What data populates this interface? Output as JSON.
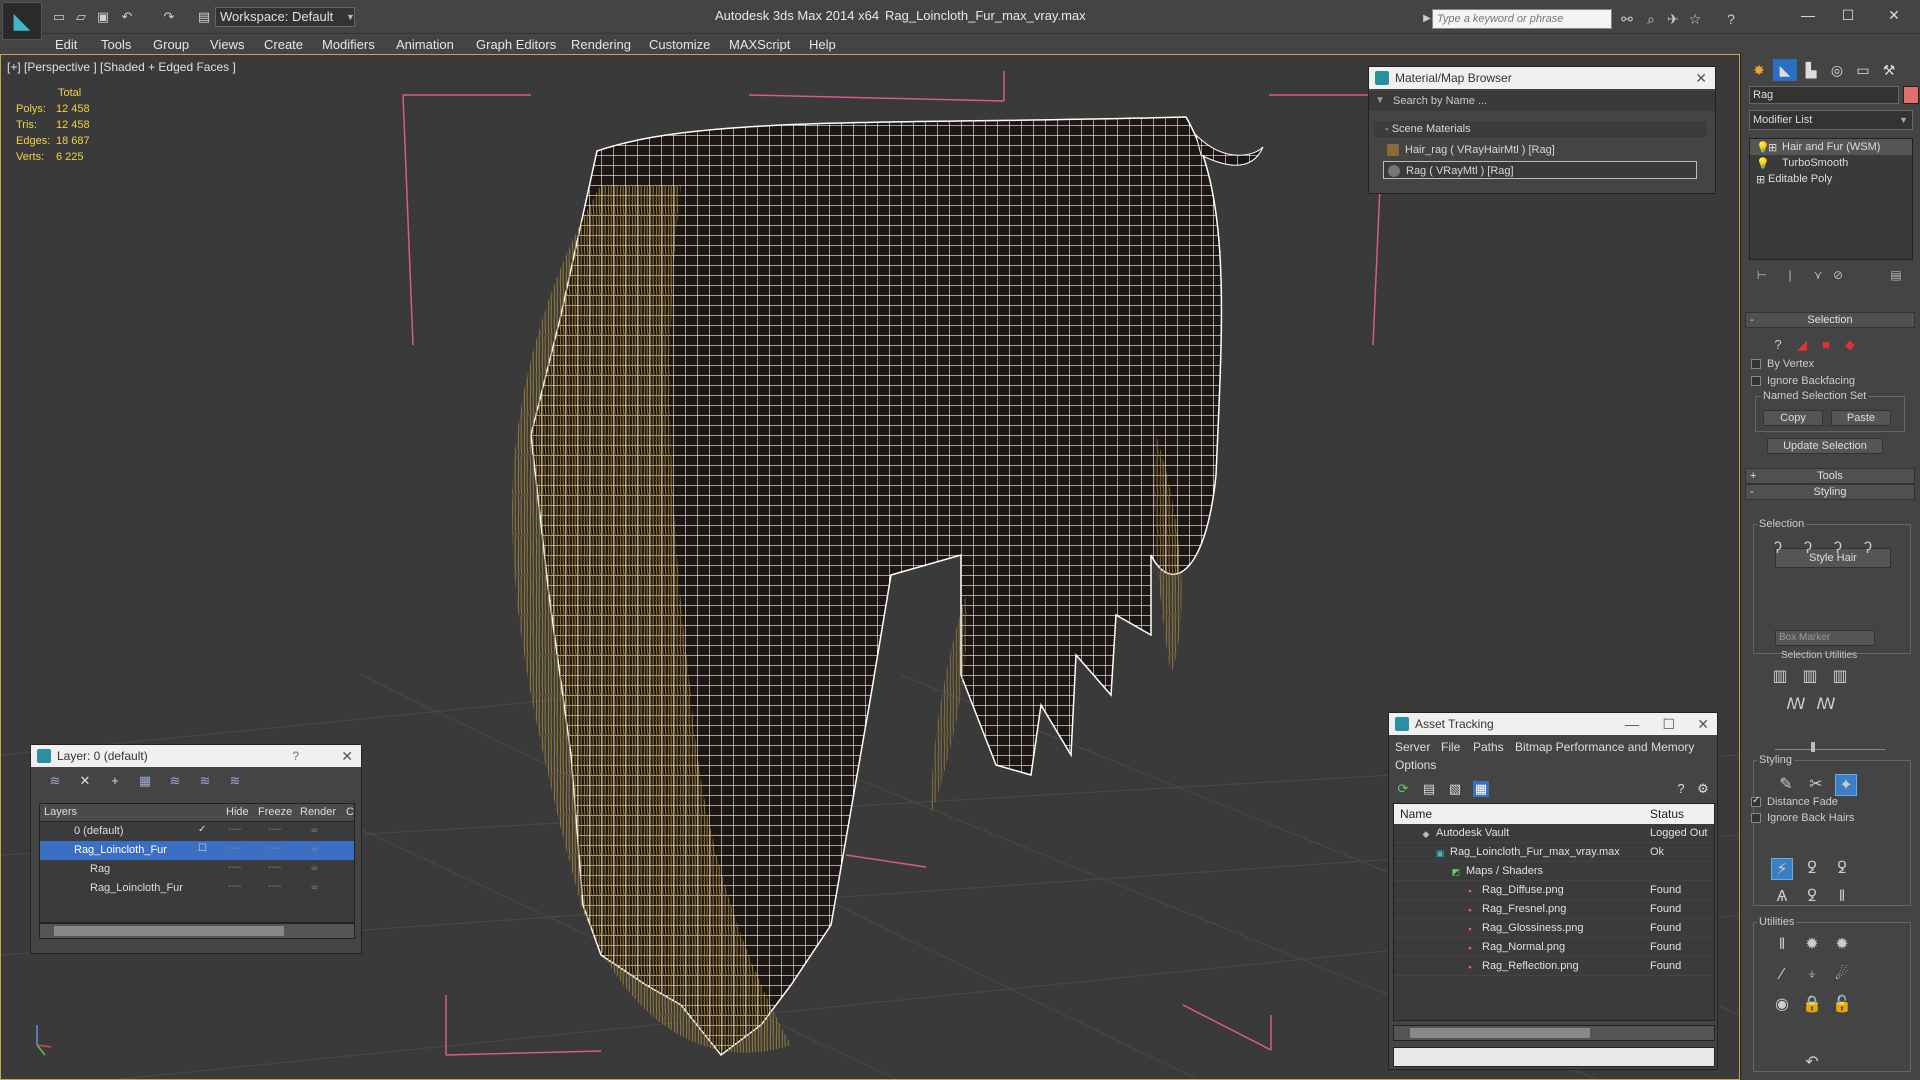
{
  "titlebar": {
    "workspace": "Workspace: Default",
    "app_title": "Autodesk 3ds Max  2014 x64",
    "file_title": "Rag_Loincloth_Fur_max_vray.max",
    "search_placeholder": "Type a keyword or phrase"
  },
  "menu": [
    "Edit",
    "Tools",
    "Group",
    "Views",
    "Create",
    "Modifiers",
    "Animation",
    "Graph Editors",
    "Rendering",
    "Customize",
    "MAXScript",
    "Help"
  ],
  "viewport": {
    "label": "[+] [Perspective ] [Shaded + Edged Faces ]",
    "stats": {
      "header": "Total",
      "rows": [
        {
          "label": "Polys:",
          "value": "12 458"
        },
        {
          "label": "Tris:",
          "value": "12 458"
        },
        {
          "label": "Edges:",
          "value": "18 687"
        },
        {
          "label": "Verts:",
          "value": "6 225"
        }
      ]
    }
  },
  "material_browser": {
    "title": "Material/Map Browser",
    "search": "Search by Name ...",
    "group": "- Scene Materials",
    "items": [
      "Hair_rag  ( VRayHairMtl ) [Rag]",
      "Rag  ( VRayMtl ) [Rag]"
    ]
  },
  "layer_panel": {
    "title": "Layer: 0 (default)",
    "help": "?",
    "columns": {
      "layers": "Layers",
      "hide": "Hide",
      "freeze": "Freeze",
      "render": "Render",
      "c": "C"
    },
    "rows": [
      {
        "name": "0 (default)"
      },
      {
        "name": "Rag_Loincloth_Fur"
      },
      {
        "name": "Rag"
      },
      {
        "name": "Rag_Loincloth_Fur"
      }
    ],
    "dash": "----"
  },
  "asset_tracking": {
    "title": "Asset Tracking",
    "menu": [
      "Server",
      "File",
      "Paths",
      "Bitmap Performance and Memory",
      "Options"
    ],
    "columns": {
      "name": "Name",
      "status": "Status"
    },
    "rows": [
      {
        "name": "Autodesk Vault",
        "status": "Logged Out"
      },
      {
        "name": "Rag_Loincloth_Fur_max_vray.max",
        "status": "Ok"
      },
      {
        "name": "Maps / Shaders",
        "status": ""
      },
      {
        "name": "Rag_Diffuse.png",
        "status": "Found"
      },
      {
        "name": "Rag_Fresnel.png",
        "status": "Found"
      },
      {
        "name": "Rag_Glossiness.png",
        "status": "Found"
      },
      {
        "name": "Rag_Normal.png",
        "status": "Found"
      },
      {
        "name": "Rag_Reflection.png",
        "status": "Found"
      }
    ]
  },
  "command_panel": {
    "object_name": "Rag",
    "modifier_list": "Modifier List",
    "stack": [
      "Hair and Fur (WSM)",
      "TurboSmooth",
      "Editable Poly"
    ],
    "selection_rollout": "Selection",
    "by_vertex": "By Vertex",
    "ignore_backfacing": "Ignore Backfacing",
    "named_selection_set": "Named Selection Set",
    "copy": "Copy",
    "paste": "Paste",
    "update_selection": "Update Selection",
    "tools_rollout": "Tools",
    "styling_rollout": "Styling",
    "style_hair": "Style Hair",
    "selection_group": "Selection",
    "box_marker": "Box Marker",
    "selection_utilities": "Selection Utilities",
    "styling_group": "Styling",
    "distance_fade": "Distance Fade",
    "ignore_back_hairs": "Ignore Back Hairs",
    "utilities_group": "Utilities"
  }
}
